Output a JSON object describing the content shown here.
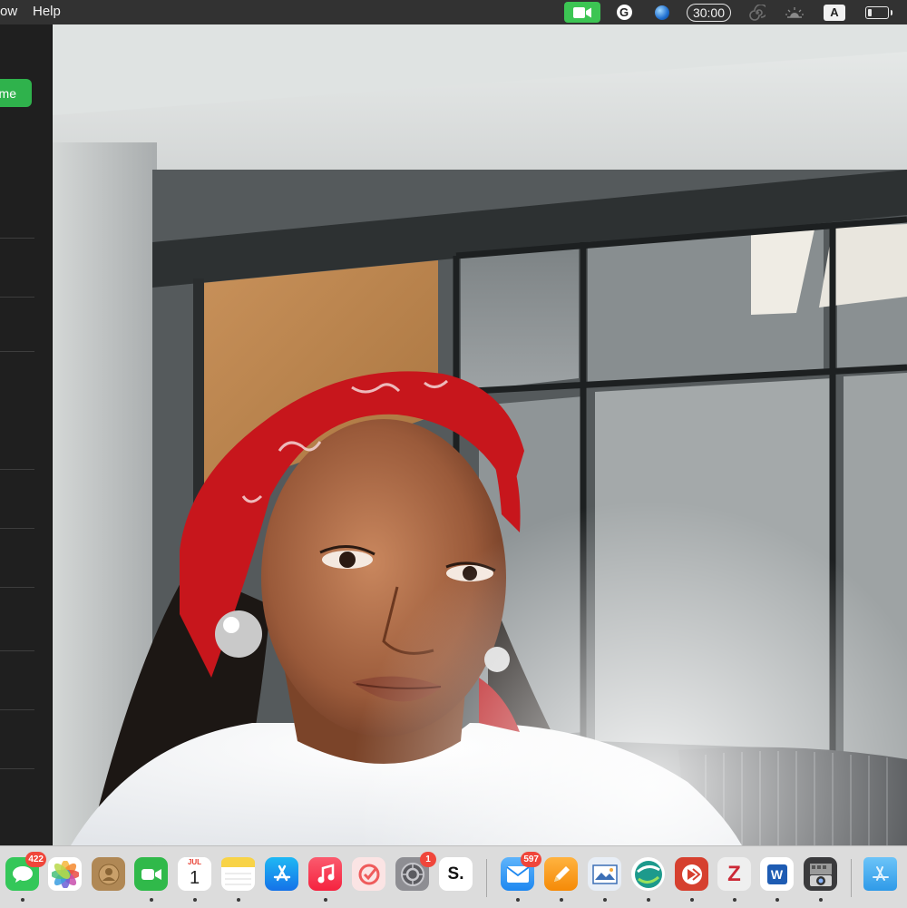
{
  "menubar": {
    "menu_partial": "ow",
    "help": "Help",
    "timer": "30:00",
    "input_source": "A",
    "g_icon_letter": "G"
  },
  "sidebar": {
    "join_button_partial": "me"
  },
  "dock": {
    "items": [
      {
        "name": "messages",
        "badge": "422"
      },
      {
        "name": "photos"
      },
      {
        "name": "contacts"
      },
      {
        "name": "facetime"
      },
      {
        "name": "calendar",
        "month": "JUL",
        "day": "1"
      },
      {
        "name": "notes"
      },
      {
        "name": "app-store"
      },
      {
        "name": "music"
      },
      {
        "name": "reminders-check"
      },
      {
        "name": "system-preferences",
        "badge": "1"
      },
      {
        "name": "scrivener",
        "label": "S."
      },
      {
        "name": "mail",
        "badge": "597"
      },
      {
        "name": "pages"
      },
      {
        "name": "preview"
      },
      {
        "name": "network-app"
      },
      {
        "name": "remote-desktop"
      },
      {
        "name": "zotero",
        "label": "Z"
      },
      {
        "name": "word",
        "label": "W"
      },
      {
        "name": "image-capture"
      },
      {
        "name": "applications-folder"
      }
    ],
    "colors": {
      "messages": "#34c759",
      "facetime": "#30b94a",
      "music": "#fa2d48",
      "mail": "#1e88f0",
      "word": "#1e5cb3",
      "zotero": "#cc2936"
    }
  }
}
